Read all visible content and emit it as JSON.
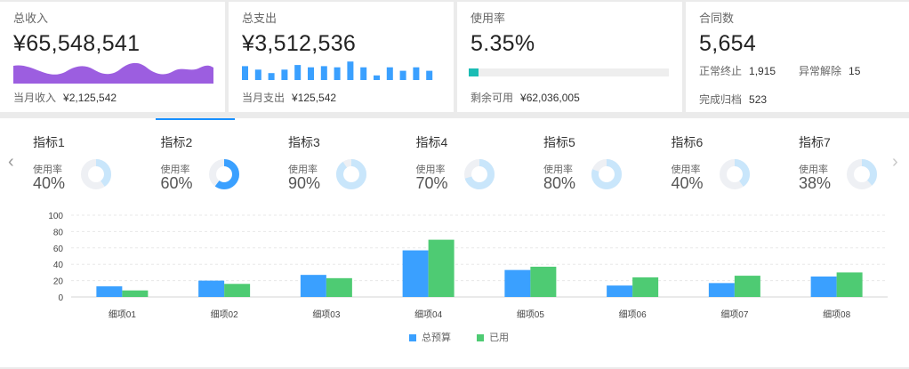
{
  "cards": {
    "income": {
      "label": "总收入",
      "value": "¥65,548,541",
      "foot_label": "当月收入",
      "foot_value": "¥2,125,542"
    },
    "expense": {
      "label": "总支出",
      "value": "¥3,512,536",
      "foot_label": "当月支出",
      "foot_value": "¥125,542",
      "mini_bars": [
        60,
        45,
        30,
        45,
        65,
        55,
        60,
        55,
        80,
        55,
        20,
        55,
        40,
        55,
        40
      ]
    },
    "usage": {
      "label": "使用率",
      "value": "5.35%",
      "progress": 0.05,
      "foot_label": "剩余可用",
      "foot_value": "¥62,036,005"
    },
    "contracts": {
      "label": "合同数",
      "value": "5,654",
      "normal_label": "正常终止",
      "normal_value": "1,915",
      "abnormal_label": "异常解除",
      "abnormal_value": "15",
      "archived_label": "完成归档",
      "archived_value": "523"
    }
  },
  "colors": {
    "purple": "#9c5ee0",
    "blue": "#3aa0ff",
    "green": "#4ecb73",
    "teal": "#1bbcb4",
    "ring_light": "#c9e6fb",
    "ring_grey": "#eef0f4",
    "ring_active": "#3aa0ff"
  },
  "tabs": [
    {
      "name": "指标1",
      "sub": "使用率",
      "value": "40%",
      "ratio": 0.4,
      "active": false
    },
    {
      "name": "指标2",
      "sub": "使用率",
      "value": "60%",
      "ratio": 0.6,
      "active": true
    },
    {
      "name": "指标3",
      "sub": "使用率",
      "value": "90%",
      "ratio": 0.9,
      "active": false
    },
    {
      "name": "指标4",
      "sub": "使用率",
      "value": "70%",
      "ratio": 0.7,
      "active": false
    },
    {
      "name": "指标5",
      "sub": "使用率",
      "value": "80%",
      "ratio": 0.8,
      "active": false
    },
    {
      "name": "指标6",
      "sub": "使用率",
      "value": "40%",
      "ratio": 0.4,
      "active": false
    },
    {
      "name": "指标7",
      "sub": "使用率",
      "value": "38%",
      "ratio": 0.38,
      "active": false
    }
  ],
  "chart_data": {
    "type": "bar",
    "categories": [
      "细项01",
      "细项02",
      "细项03",
      "细项04",
      "细项05",
      "细项06",
      "细项07",
      "细项08"
    ],
    "series": [
      {
        "name": "总预算",
        "values": [
          13,
          20,
          27,
          57,
          33,
          14,
          17,
          25
        ]
      },
      {
        "name": "已用",
        "values": [
          8,
          16,
          23,
          70,
          37,
          24,
          26,
          30
        ]
      }
    ],
    "ylim": [
      0,
      100
    ],
    "yticks": [
      0,
      20,
      40,
      60,
      80,
      100
    ],
    "grid": true,
    "legend": "bottom"
  }
}
